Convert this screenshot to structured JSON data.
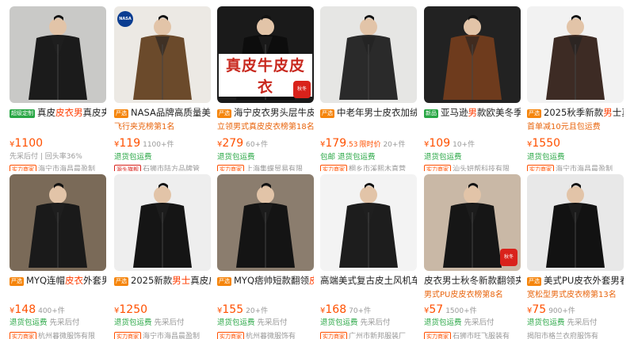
{
  "products": [
    {
      "tag": "超级定制",
      "tag_color": "green",
      "title_pre": "真皮",
      "title_hl": "皮衣男",
      "title_post": "真皮夹克",
      "price_int": "1100",
      "price_dec": "",
      "sold": "",
      "extra": "先采后付 | 回头率36%",
      "ship": "",
      "shop_badge": "实力商家",
      "shop": "海宁市海昌晨盈制",
      "overlay": "",
      "bg": "#c9c9c7",
      "jacket": "#1b1b1b",
      "sticker": "",
      "nasa": false
    },
    {
      "tag": "严选",
      "tag_color": "orange",
      "title_pre": "NASA品牌高质量美式",
      "title_hl": "",
      "title_post": "",
      "sub": "飞行夹克榜第1名",
      "price_int": "119",
      "price_dec": "",
      "sold": "1100+件",
      "extra": "",
      "ship": "退货包运费",
      "shop_badge": "源头旗舰",
      "shop": "石狮市陆方品牌管",
      "overlay": "",
      "bg": "#ece9e4",
      "jacket": "#6b4a2b",
      "sticker": "",
      "nasa": true
    },
    {
      "tag": "严选",
      "tag_color": "orange",
      "title_pre": "海宁皮衣男头层牛皮立",
      "title_hl": "",
      "title_post": "",
      "sub": "立领男式真皮皮衣榜第18名",
      "price_int": "279",
      "price_dec": "",
      "sold": "60+件",
      "extra": "",
      "ship": "退货包运费",
      "shop_badge": "实力商家",
      "shop": "上海集蝶贸易有限",
      "overlay": "真皮牛皮皮衣",
      "bg": "#1a1a1a",
      "jacket": "#0d0d0d",
      "sticker": "秋冬",
      "nasa": false
    },
    {
      "tag": "严选",
      "tag_color": "orange",
      "title_pre": "中老年男士皮衣加绒加",
      "title_hl": "",
      "title_post": "",
      "sub": "",
      "price_int": "179",
      "price_dec": ".53",
      "sold": "20+件",
      "flag": "限时价",
      "extra": "",
      "ship": "包邮 退货包运费",
      "shop_badge": "实力商家",
      "shop": "桐乡市溪熙木直营",
      "overlay": "",
      "bg": "#e6e6e4",
      "jacket": "#2a2a2a",
      "sticker": "",
      "nasa": false
    },
    {
      "tag": "新品",
      "tag_color": "green",
      "title_pre": "亚马逊",
      "title_hl": "男",
      "title_post": "款欧美冬季跨",
      "sub": "",
      "price_int": "109",
      "price_dec": "",
      "sold": "10+件",
      "extra": "",
      "ship": "退货包运费",
      "shop_badge": "实力商家",
      "shop": "汕头妍帮科技有限",
      "overlay": "",
      "bg": "#222",
      "jacket": "#6e3b1d",
      "sticker": "",
      "nasa": false
    },
    {
      "tag": "严选",
      "tag_color": "orange",
      "title_pre": "2025秋季新款",
      "title_hl": "男",
      "title_post": "士真皮",
      "sub": "首单减10元且包运费",
      "price_int": "1550",
      "price_dec": "",
      "sold": "",
      "extra": "",
      "ship": "退货包运费",
      "shop_badge": "实力商家",
      "shop": "海宁市海昌晨盈制",
      "overlay": "",
      "bg": "#f2f2f2",
      "jacket": "#3d2b24",
      "sticker": "",
      "nasa": false
    },
    {
      "tag": "严选",
      "tag_color": "orange",
      "title_pre": "MYQ连帽",
      "title_hl": "皮衣",
      "title_post": "外套男2",
      "sub": "",
      "price_int": "148",
      "price_dec": "",
      "sold": "400+件",
      "extra": "",
      "ship": "退货包运费",
      "ship_r": "先采后付",
      "shop_badge": "实力商家",
      "shop": "杭州暮微服饰有限",
      "overlay": "",
      "bg": "#7a6a58",
      "jacket": "#1a1a1a",
      "sticker": "",
      "nasa": false
    },
    {
      "tag": "严选",
      "tag_color": "orange",
      "title_pre": "2025新款",
      "title_hl": "男士",
      "title_post": "真皮皮衣",
      "sub": "",
      "price_int": "1250",
      "price_dec": "",
      "sold": "",
      "extra": "",
      "ship": "退货包运费",
      "ship_r": "先采后付",
      "shop_badge": "实力商家",
      "shop": "海宁市海昌晨盈制",
      "overlay": "",
      "bg": "#eeeeee",
      "jacket": "#151515",
      "sticker": "",
      "nasa": false
    },
    {
      "tag": "严选",
      "tag_color": "orange",
      "title_pre": "MYQ痞帅短款翻领",
      "title_hl": "皮衣",
      "title_post": "",
      "sub": "",
      "price_int": "155",
      "price_dec": "",
      "sold": "20+件",
      "extra": "",
      "ship": "退货包运费",
      "ship_r": "先采后付",
      "shop_badge": "实力商家",
      "shop": "杭州暮微服饰有",
      "overlay": "",
      "bg": "#8b7d6e",
      "jacket": "#141414",
      "sticker": "",
      "nasa": false
    },
    {
      "tag": "",
      "tag_color": "",
      "title_pre": "高端美式复古皮土风机车皮",
      "title_hl": "",
      "title_post": "",
      "sub": "",
      "price_int": "168",
      "price_dec": "",
      "sold": "70+件",
      "extra": "",
      "ship": "退货包运费",
      "ship_r": "先采后付",
      "shop_badge": "实力商家",
      "shop": "广州市新邦服装厂",
      "overlay": "",
      "bg": "#f3f3f3",
      "jacket": "#1d1d1d",
      "sticker": "",
      "nasa": false
    },
    {
      "tag": "",
      "tag_color": "",
      "title_pre": "皮衣男士秋冬新款翻领夹",
      "title_hl": "",
      "title_post": "",
      "sub": "男式PU皮皮衣榜第8名",
      "price_int": "57",
      "price_dec": "",
      "sold": "1500+件",
      "extra": "",
      "ship": "退货包运费",
      "ship_r": "先采后付",
      "shop_badge": "实力商家",
      "shop": "石狮市旺飞服装有",
      "overlay": "",
      "bg": "#c9b8a6",
      "jacket": "#161616",
      "sticker": "秋冬",
      "nasa": false
    },
    {
      "tag": "严选",
      "tag_color": "orange",
      "title_pre": "美式PU皮衣外套男春秋",
      "title_hl": "",
      "title_post": "",
      "sub": "宽松型男式皮衣榜第13名",
      "price_int": "75",
      "price_dec": "",
      "sold": "900+件",
      "extra": "",
      "ship": "退货包运费",
      "ship_r": "先采后付",
      "shop_badge": "",
      "shop": "揭阳市格兰衣府服饰有",
      "overlay": "",
      "bg": "#e8e8e8",
      "jacket": "#121212",
      "sticker": "",
      "nasa": false
    }
  ],
  "currency": "¥"
}
